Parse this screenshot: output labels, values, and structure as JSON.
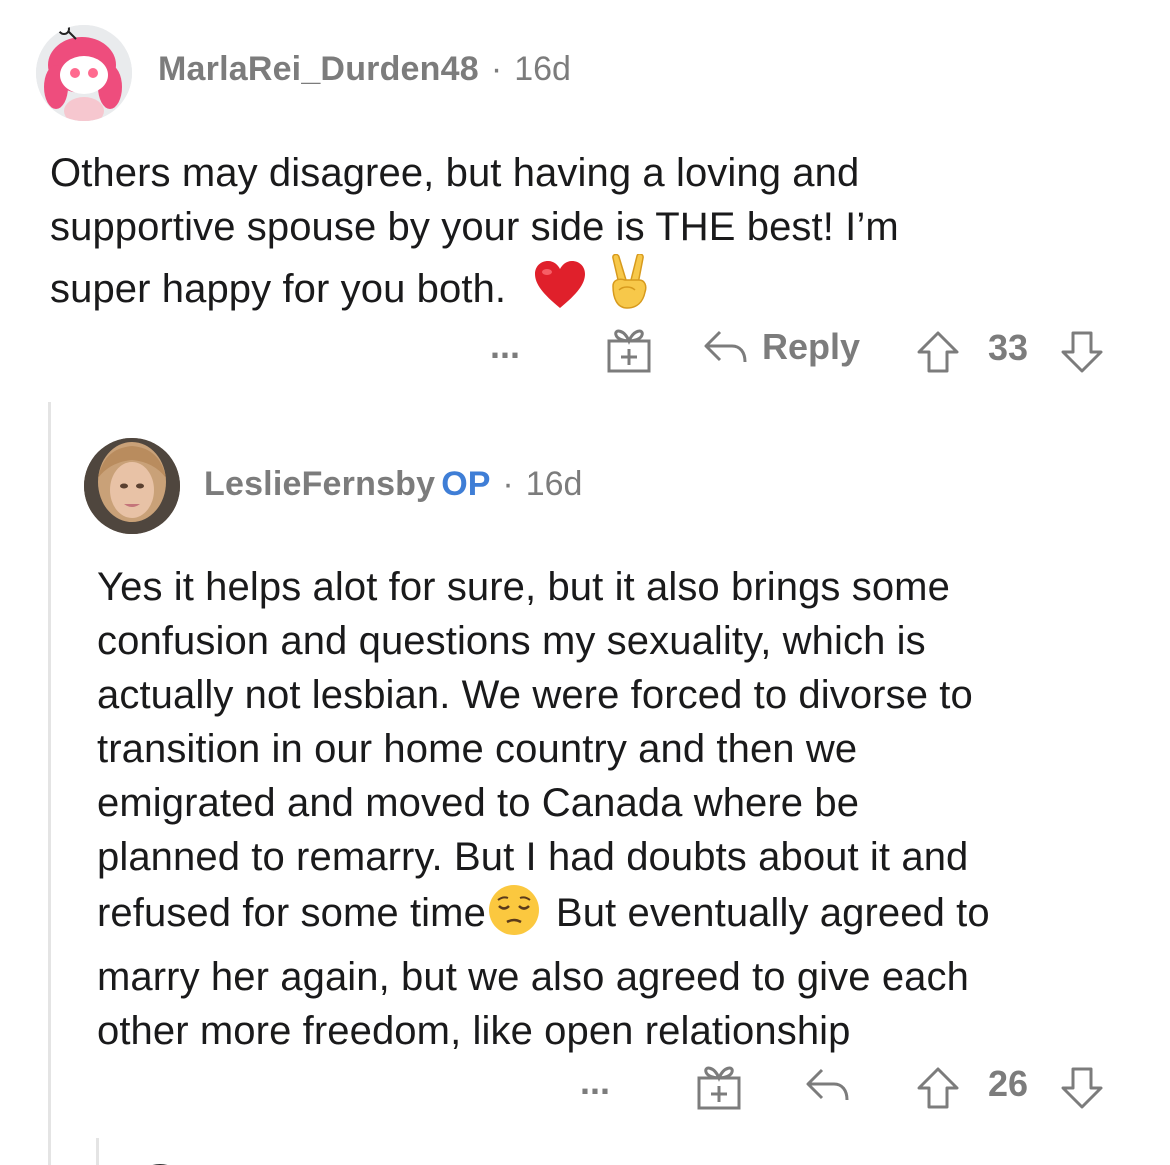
{
  "comments": [
    {
      "username": "MarlaRei_Durden48",
      "separator": "·",
      "age": "16d",
      "body_lines": [
        "Others may disagree, but having a loving and",
        "supportive spouse by your side is THE best! I’m",
        "super happy for you both."
      ],
      "body_emojis": [
        "heart-emoji",
        "victory-hand-emoji"
      ],
      "actions": {
        "more": "...",
        "award_icon": "gift-icon",
        "reply_label": "Reply",
        "upvote_icon": "arrow-up-icon",
        "score": "33",
        "downvote_icon": "arrow-down-icon"
      }
    },
    {
      "username": "LeslieFernsby",
      "op_badge": "OP",
      "separator": "·",
      "age": "16d",
      "body_lines": [
        "Yes it helps alot for sure, but it also brings some",
        "confusion and questions my sexuality, which is",
        "actually not lesbian. We were forced to divorse to",
        "transition in our home country and then we",
        "emigrated and moved to Canada where be",
        "planned to remarry. But I had doubts about it and",
        "refused for some time",
        "But eventually agreed to",
        "marry her again, but we also agreed to give each",
        "other more freedom, like open relationship"
      ],
      "body_emojis": [
        "pensive-face-emoji"
      ],
      "actions": {
        "more": "...",
        "award_icon": "gift-icon",
        "reply_icon": "reply-arrow-icon",
        "upvote_icon": "arrow-up-icon",
        "score": "26",
        "downvote_icon": "arrow-down-icon"
      }
    }
  ],
  "colors": {
    "text": "#1a1a1b",
    "meta": "#7c7c7c",
    "op_badge": "#3f7ed6",
    "thread_line": "#e4e4e4",
    "heart": "#e0202b"
  }
}
